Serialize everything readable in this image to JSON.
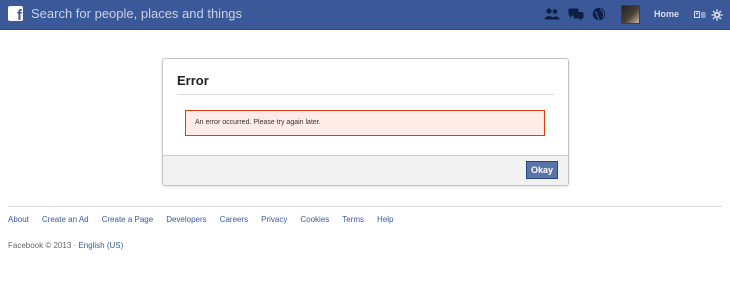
{
  "topbar": {
    "search_placeholder": "Search for people, places and things",
    "home_label": "Home",
    "icons": [
      "facebook-logo-icon",
      "friends-icon",
      "messages-icon",
      "notifications-icon",
      "privacy-shortcuts-icon",
      "settings-icon"
    ],
    "bar_color": "#3b5998"
  },
  "dialog": {
    "title": "Error",
    "message": "An error occurred. Please try again later.",
    "okay_label": "Okay",
    "error_bg": "#ffebe8",
    "error_border": "#dd3c10"
  },
  "footer": {
    "links": [
      "About",
      "Create an Ad",
      "Create a Page",
      "Developers",
      "Careers",
      "Privacy",
      "Cookies",
      "Terms",
      "Help"
    ],
    "copyright": "Facebook © 2013 · ",
    "language": "English (US)"
  }
}
